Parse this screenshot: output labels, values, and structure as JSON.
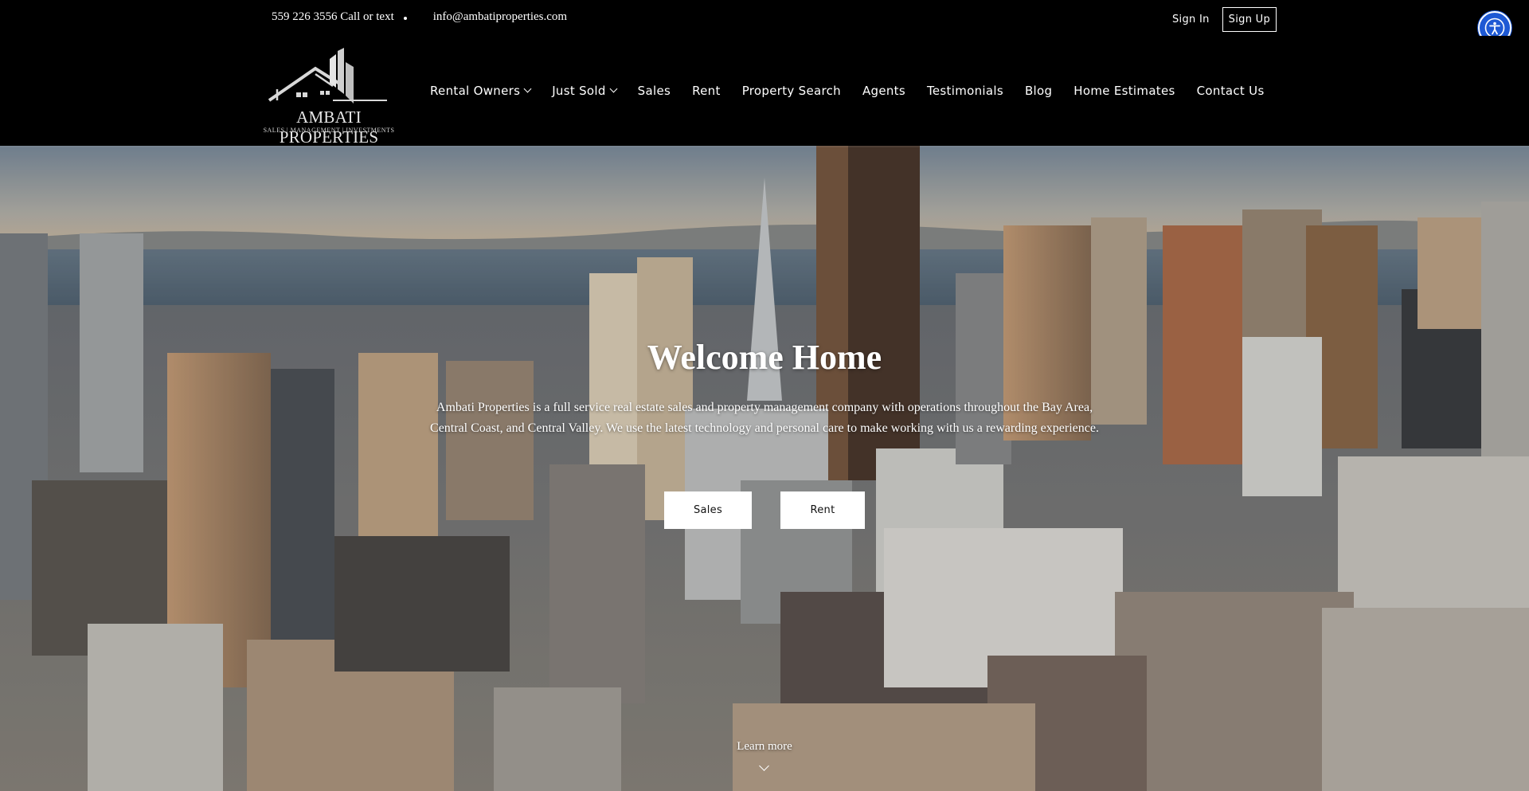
{
  "topbar": {
    "phone": "559 226 3556 Call or text",
    "email": "info@ambatiproperties.com",
    "sign_in": "Sign In",
    "sign_up": "Sign Up"
  },
  "logo": {
    "name": "AMBATI PROPERTIES",
    "tagline": "SALES | MANAGEMENT | INVESTMENTS"
  },
  "nav": {
    "items": [
      {
        "label": "Rental Owners",
        "dropdown": true
      },
      {
        "label": "Just Sold",
        "dropdown": true
      },
      {
        "label": "Sales"
      },
      {
        "label": "Rent"
      },
      {
        "label": "Property Search"
      },
      {
        "label": "Agents"
      },
      {
        "label": "Testimonials"
      },
      {
        "label": "Blog"
      },
      {
        "label": "Home Estimates"
      },
      {
        "label": "Contact Us"
      }
    ]
  },
  "hero": {
    "title": "Welcome Home",
    "description": "Ambati Properties is a full service real estate sales and property management company with operations throughout the Bay Area, Central Coast, and Central Valley. We use the latest technology and personal care to make working with us a rewarding experience.",
    "buttons": {
      "sales": "Sales",
      "rent": "Rent"
    },
    "learn_more": "Learn more"
  },
  "icons": {
    "accessibility": "accessibility-icon",
    "chevron": "chevron-down-icon"
  },
  "colors": {
    "accessibility_blue": "#1e59d4",
    "header_bg": "#000000"
  }
}
